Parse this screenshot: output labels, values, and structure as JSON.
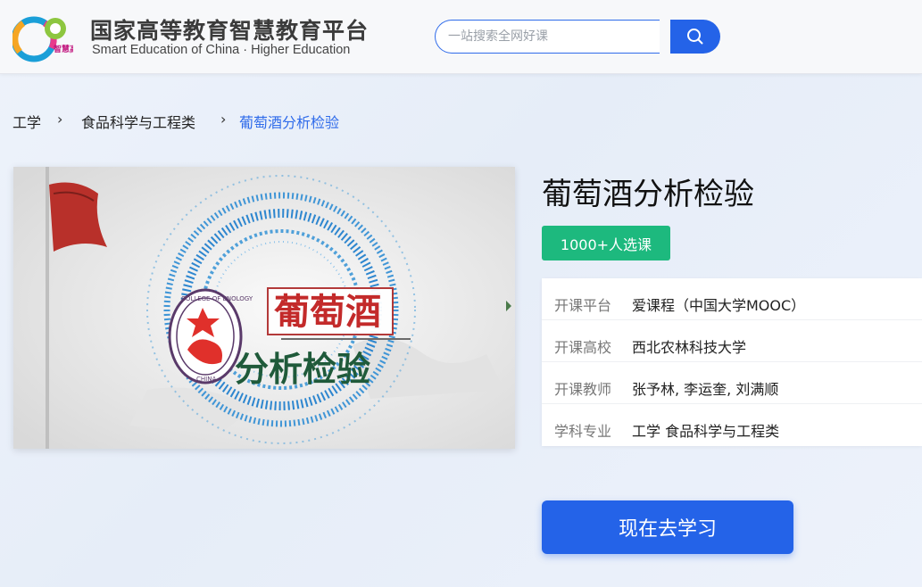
{
  "header": {
    "logo_badge": "智慧高教",
    "logo_title": "国家高等教育智慧教育平台",
    "logo_subtitle": "Smart Education of China · Higher Education",
    "search_placeholder": "一站搜索全网好课"
  },
  "breadcrumb": {
    "items": [
      "工学",
      "食品科学与工程类",
      "葡萄酒分析检验"
    ],
    "separator": "›"
  },
  "cover": {
    "title_line1": "葡萄酒",
    "title_line2": "分析检验",
    "seal_text": "COLLEGE OF ENOLOGY",
    "seal_bottom": "CHINA"
  },
  "course": {
    "title": "葡萄酒分析检验",
    "enroll_badge": "1000+人选课",
    "info": [
      {
        "label": "开课平台",
        "value": "爱课程（中国大学MOOC）"
      },
      {
        "label": "开课高校",
        "value": "西北农林科技大学"
      },
      {
        "label": "开课教师",
        "value": "张予林, 李运奎, 刘满顺"
      },
      {
        "label": "学科专业",
        "value": "工学 食品科学与工程类"
      }
    ],
    "study_button": "现在去学习"
  },
  "colors": {
    "primary": "#2463e8",
    "badge_green": "#1db97e",
    "breadcrumb_active": "#2f6bea"
  },
  "icons": [
    "platform-logo-icon",
    "search-icon"
  ]
}
